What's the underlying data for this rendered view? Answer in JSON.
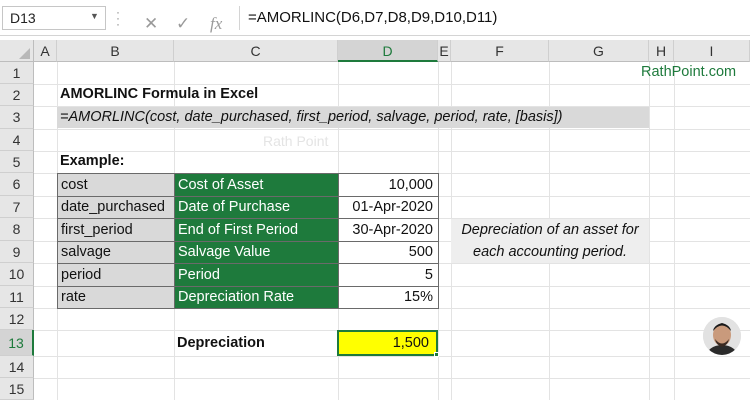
{
  "formula_bar": {
    "name_box": "D13",
    "formula": "=AMORLINC(D6,D7,D8,D9,D10,D11)",
    "icons": [
      "cancel-icon",
      "enter-icon",
      "function-icon"
    ]
  },
  "columns": [
    "A",
    "B",
    "C",
    "D",
    "E",
    "F",
    "G",
    "H",
    "I"
  ],
  "rows": [
    "1",
    "2",
    "3",
    "4",
    "5",
    "6",
    "7",
    "8",
    "9",
    "10",
    "11",
    "12",
    "13",
    "14",
    "15"
  ],
  "sheet": {
    "brand": "RathPoint.com",
    "title": "AMORLINC Formula in Excel",
    "syntax": "=AMORLINC(cost, date_purchased, first_period, salvage, period, rate, [basis])",
    "watermark": "Rath Point",
    "example_label": "Example:",
    "table": [
      {
        "arg": "cost",
        "desc": "Cost of Asset",
        "value": "10,000"
      },
      {
        "arg": "date_purchased",
        "desc": "Date of Purchase",
        "value": "01-Apr-2020"
      },
      {
        "arg": "first_period",
        "desc": "End of First Period",
        "value": "30-Apr-2020"
      },
      {
        "arg": "salvage",
        "desc": "Salvage Value",
        "value": "500"
      },
      {
        "arg": "period",
        "desc": "Period",
        "value": "5"
      },
      {
        "arg": "rate",
        "desc": "Depreciation Rate",
        "value": "15%"
      }
    ],
    "note_line1": "Depreciation of an asset for",
    "note_line2": "each accounting period.",
    "result_label": "Depreciation",
    "result_value": "1,500"
  },
  "colors": {
    "green": "#1e7a3c",
    "highlight": "#ffff00",
    "gray": "#d9d9d9"
  }
}
